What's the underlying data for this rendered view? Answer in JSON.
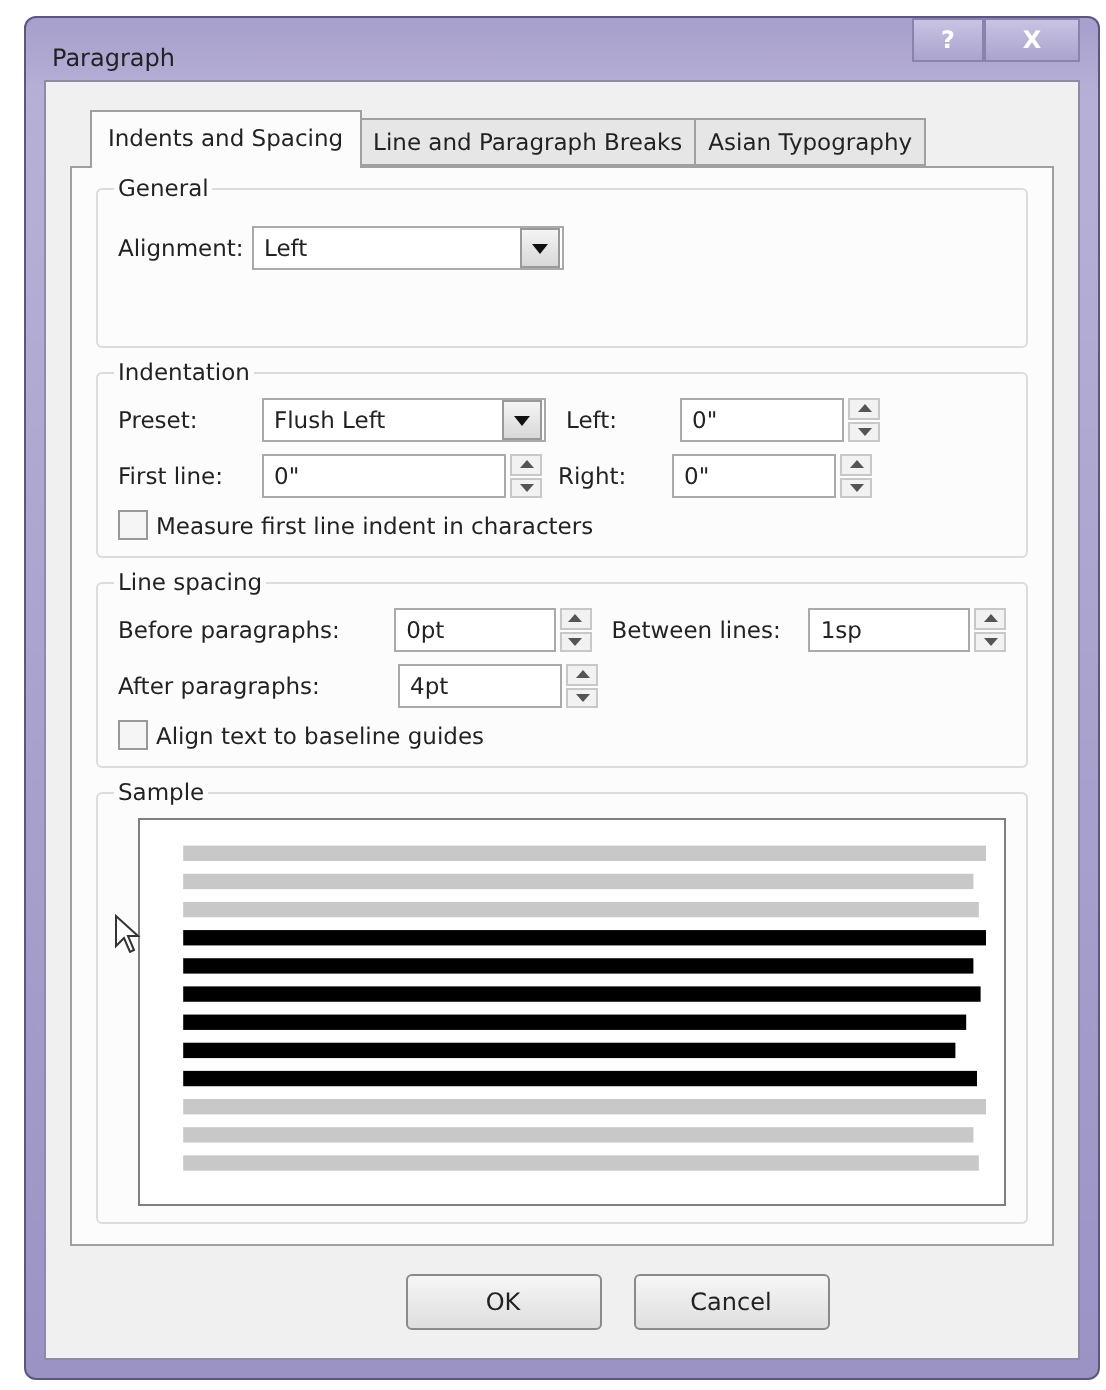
{
  "window": {
    "title": "Paragraph",
    "help_button": "?",
    "close_button": "X"
  },
  "tabs": [
    {
      "label": "Indents and Spacing",
      "selected": true
    },
    {
      "label": "Line and Paragraph Breaks",
      "selected": false
    },
    {
      "label": "Asian Typography",
      "selected": false
    }
  ],
  "general": {
    "title": "General",
    "alignment_label": "Alignment:",
    "alignment_value": "Left"
  },
  "indentation": {
    "title": "Indentation",
    "preset_label": "Preset:",
    "preset_value": "Flush Left",
    "left_label": "Left:",
    "left_value": "0\"",
    "first_line_label": "First line:",
    "first_line_value": "0\"",
    "right_label": "Right:",
    "right_value": "0\"",
    "measure_checkbox": {
      "label": "Measure first line indent in characters",
      "checked": false
    }
  },
  "line_spacing": {
    "title": "Line spacing",
    "before_label": "Before paragraphs:",
    "before_value": "0pt",
    "between_label": "Between lines:",
    "between_value": "1sp",
    "after_label": "After paragraphs:",
    "after_value": "4pt",
    "baseline_checkbox": {
      "label": "Align text to baseline guides",
      "checked": false
    }
  },
  "sample": {
    "title": "Sample"
  },
  "buttons": [
    "OK",
    "Cancel"
  ]
}
